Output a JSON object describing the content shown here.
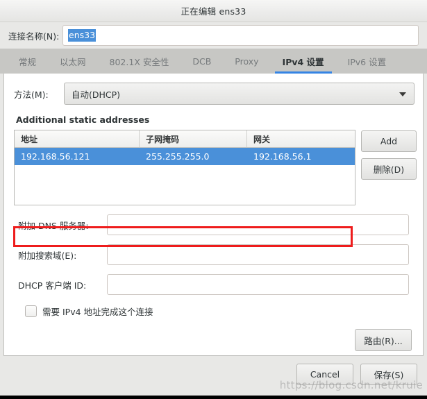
{
  "window": {
    "title": "正在编辑 ens33"
  },
  "connection": {
    "name_label": "连接名称(N):",
    "name_value": "ens33"
  },
  "tabs": [
    {
      "label": "常规",
      "active": false
    },
    {
      "label": "以太网",
      "active": false
    },
    {
      "label": "802.1X 安全性",
      "active": false
    },
    {
      "label": "DCB",
      "active": false
    },
    {
      "label": "Proxy",
      "active": false
    },
    {
      "label": "IPv4 设置",
      "active": true
    },
    {
      "label": "IPv6 设置",
      "active": false
    }
  ],
  "method": {
    "label": "方法(M):",
    "value": "自动(DHCP)",
    "arrow_icon": "chevron-down-icon"
  },
  "addresses": {
    "section_title": "Additional static addresses",
    "headers": [
      "地址",
      "子网掩码",
      "网关"
    ],
    "rows": [
      {
        "address": "192.168.56.121",
        "netmask": "255.255.255.0",
        "gateway": "192.168.56.1",
        "selected": true
      }
    ],
    "add_label": "Add",
    "delete_label": "删除(D)",
    "highlight_color": "#ee1c1c",
    "selection_color": "#4a90d9"
  },
  "fields": [
    {
      "label": "附加 DNS 服务器:",
      "value": "",
      "placeholder": ""
    },
    {
      "label": "附加搜索域(E):",
      "value": "",
      "placeholder": ""
    },
    {
      "label": "DHCP 客户端 ID:",
      "value": "",
      "placeholder": ""
    }
  ],
  "require_ipv4": {
    "label": "需要 IPv4 地址完成这个连接",
    "checked": false
  },
  "routes": {
    "label": "路由(R)..."
  },
  "actions": {
    "cancel_label": "Cancel",
    "save_label": "保存(S)"
  },
  "watermark": {
    "text": "https://blog.csdn.net/kruie"
  }
}
